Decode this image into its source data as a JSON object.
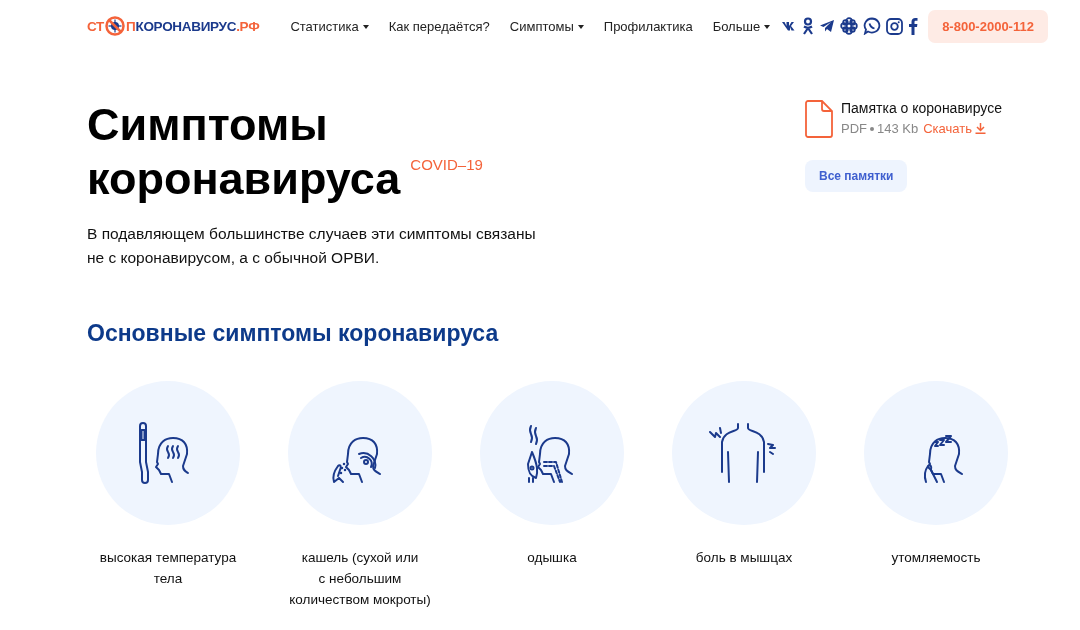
{
  "header": {
    "logo": {
      "prefix": "СТ",
      "name_parts": [
        {
          "text": "П",
          "accent": true
        },
        {
          "text": "КОРОНАВИРУС",
          "accent": false
        },
        {
          "text": ".РФ",
          "accent": true
        }
      ]
    },
    "nav": [
      {
        "label": "Статистика",
        "dropdown": true
      },
      {
        "label": "Как передаётся?",
        "dropdown": false
      },
      {
        "label": "Симптомы",
        "dropdown": true
      },
      {
        "label": "Профилактика",
        "dropdown": false
      },
      {
        "label": "Больше",
        "dropdown": true
      }
    ],
    "socials": [
      {
        "kind": "vk"
      },
      {
        "kind": "ok"
      },
      {
        "kind": "telegram"
      },
      {
        "kind": "flower"
      },
      {
        "kind": "viber"
      },
      {
        "kind": "instagram"
      },
      {
        "kind": "facebook"
      }
    ],
    "phone": "8-800-2000-112"
  },
  "hero": {
    "title_line1": "Симптомы",
    "title_line2": "коронавируса",
    "tag": "COVID–19",
    "intro_line1": "В подавляющем большинстве случаев эти симптомы связаны",
    "intro_line2": "не с коронавирусом, а с обычной ОРВИ."
  },
  "memo": {
    "title": "Памятка о коронавирусе",
    "format": "PDF",
    "size": "143 Kb",
    "download": "Скачать",
    "all_button": "Все памятки"
  },
  "symptoms": {
    "heading": "Основные симптомы коронавируса",
    "items": [
      {
        "kind": "fever",
        "label_lines": [
          "высокая температура",
          "тела"
        ]
      },
      {
        "kind": "cough",
        "label_lines": [
          "кашель (сухой или",
          "с небольшим",
          "количеством мокроты)"
        ]
      },
      {
        "kind": "breath",
        "label_lines": [
          "одышка"
        ]
      },
      {
        "kind": "muscle",
        "label_lines": [
          "боль в мышцах"
        ]
      },
      {
        "kind": "fatigue",
        "label_lines": [
          "утомляемость"
        ]
      }
    ]
  }
}
